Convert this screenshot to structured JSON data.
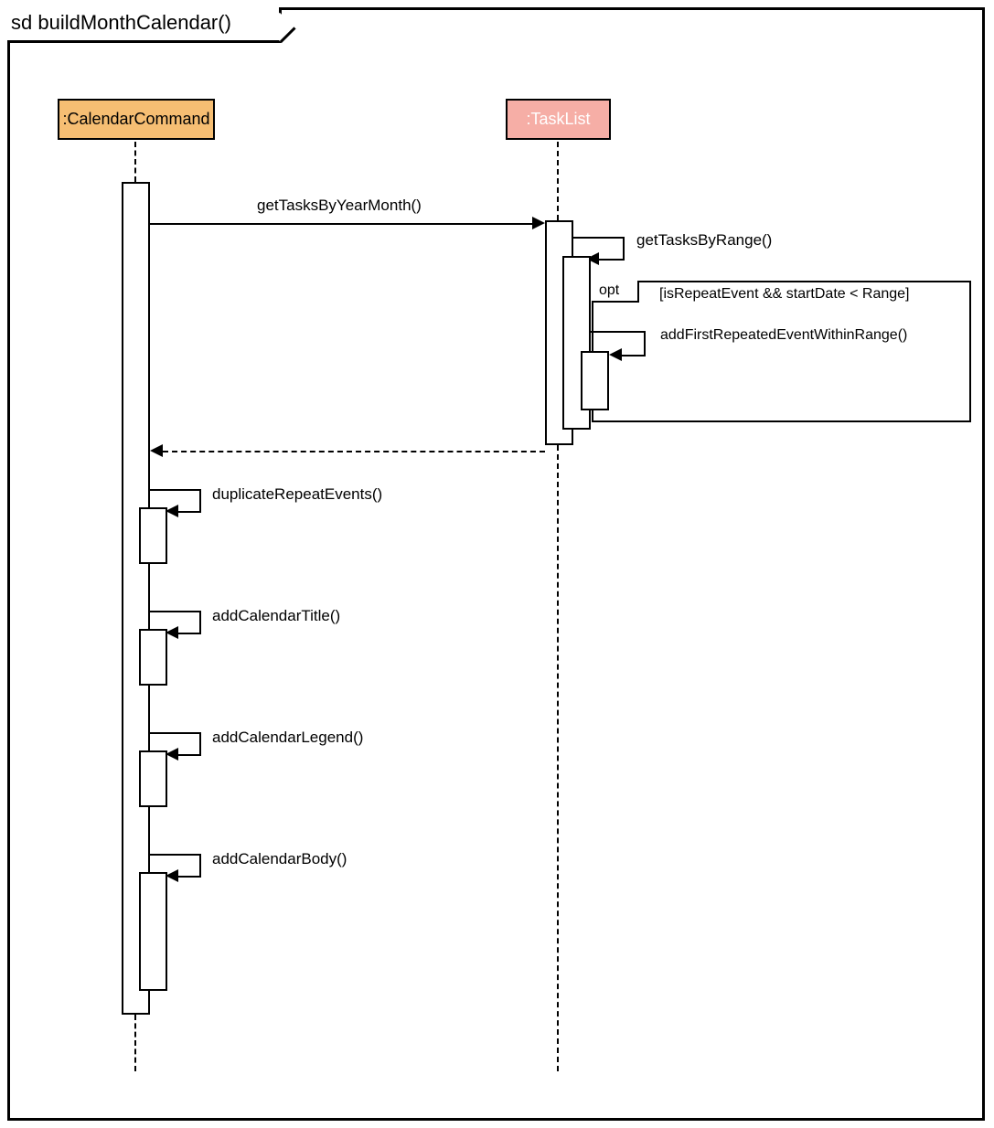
{
  "diagram": {
    "frame_label": "sd buildMonthCalendar()",
    "lifelines": {
      "calendar": ":CalendarCommand",
      "tasklist": ":TaskList"
    },
    "messages": {
      "m1": "getTasksByYearMonth()",
      "m2": "getTasksByRange()",
      "m3": "addFirstRepeatedEventWithinRange()",
      "m4": "duplicateRepeatEvents()",
      "m5": "addCalendarTitle()",
      "m6": "addCalendarLegend()",
      "m7": "addCalendarBody()"
    },
    "opt": {
      "label": "opt",
      "guard": "[isRepeatEvent && startDate < Range]"
    }
  }
}
